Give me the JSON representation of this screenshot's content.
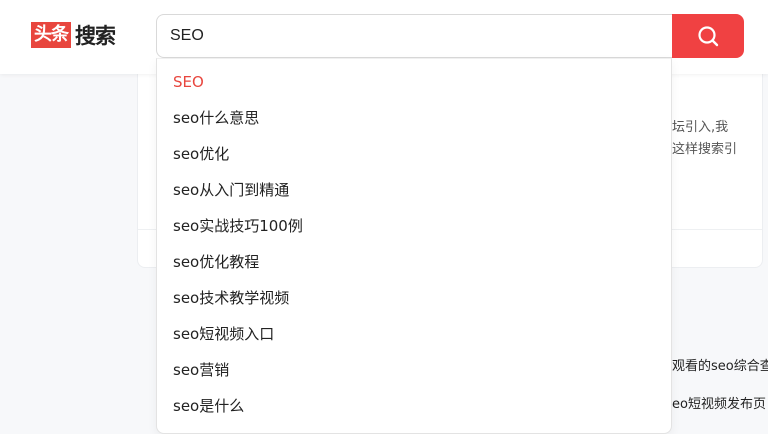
{
  "logo": {
    "badge": "头条",
    "text": "搜索"
  },
  "search": {
    "value": "SEO",
    "button_icon": "search-icon"
  },
  "suggestions": [
    "SEO",
    "seo什么意思",
    "seo优化",
    "seo从入门到精通",
    "seo实战技巧100例",
    "seo优化教程",
    "seo技术教学视频",
    "seo短视频入口",
    "seo营销",
    "seo是什么"
  ],
  "background": {
    "snippet_1": "坛引入,我",
    "snippet_2": "这样搜索引",
    "snippet_3": "观看的seo综合查",
    "snippet_4": "eo短视频发布页"
  },
  "colors": {
    "brand": "#e8463e",
    "button": "#f04142"
  }
}
